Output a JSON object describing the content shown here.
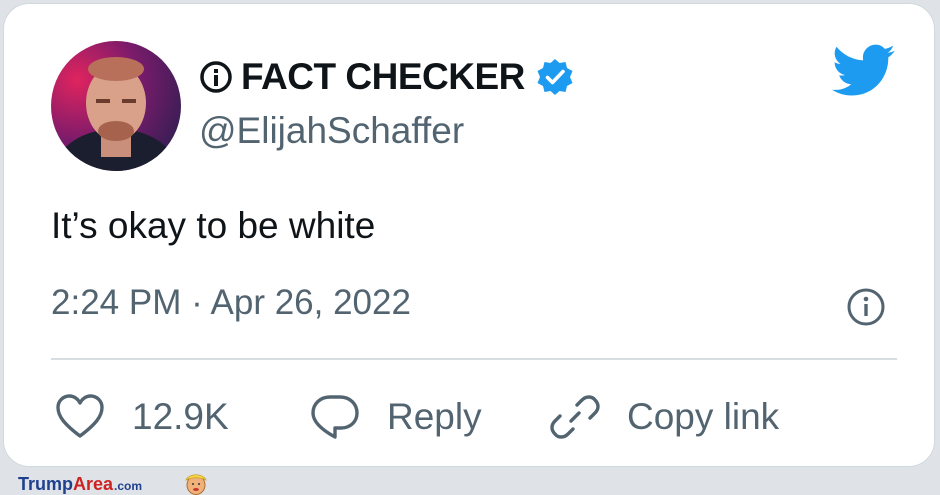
{
  "author": {
    "name": "FACT CHECKER",
    "handle": "@ElijahSchaffer",
    "verified": true
  },
  "tweet": {
    "text": "It’s okay to be white",
    "timestamp": "2:24 PM · Apr 26, 2022"
  },
  "actions": {
    "likes": "12.9K",
    "reply_label": "Reply",
    "copy_link_label": "Copy link"
  },
  "watermark": {
    "brand_part1": "Trump",
    "brand_part2": "Area",
    "brand_suffix": ".com"
  },
  "colors": {
    "twitter_blue": "#1d9bf0",
    "text_primary": "#0f1419",
    "text_secondary": "#536471"
  },
  "icons": [
    "info-circle-icon",
    "verified-badge-icon",
    "twitter-bird-icon",
    "heart-icon",
    "reply-bubble-icon",
    "link-icon"
  ]
}
